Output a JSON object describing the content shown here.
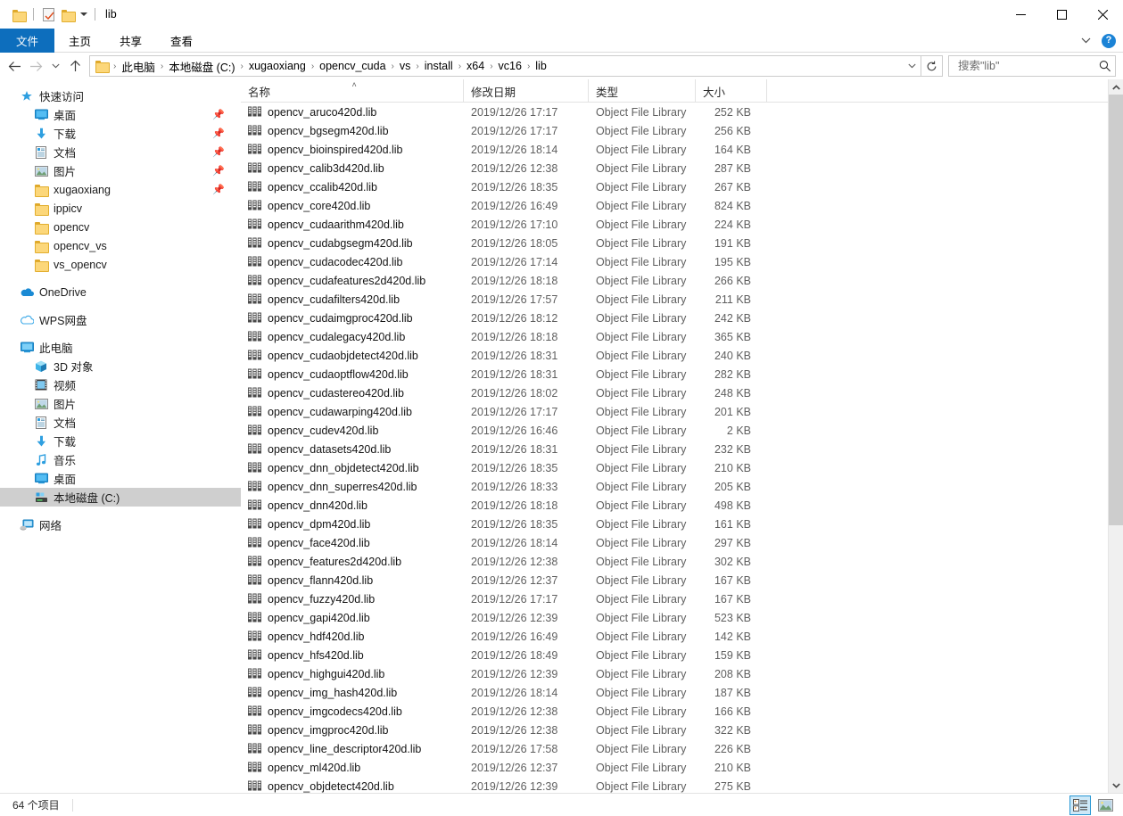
{
  "window": {
    "title": "lib",
    "quick_access": [
      {
        "name": "folder-icon",
        "label": "打开"
      },
      {
        "name": "properties-icon",
        "label": "属性"
      },
      {
        "name": "new-folder-icon",
        "label": "新建文件夹"
      }
    ],
    "controls": {
      "minimize": "─",
      "maximize": "□",
      "close": "✕"
    }
  },
  "ribbon": {
    "tabs": [
      {
        "label": "文件",
        "active": true
      },
      {
        "label": "主页",
        "active": false
      },
      {
        "label": "共享",
        "active": false
      },
      {
        "label": "查看",
        "active": false
      }
    ],
    "collapse_label": "⌄",
    "help_label": "?"
  },
  "addressbar": {
    "back": "←",
    "forward": "→",
    "recent": "⌄",
    "up": "↑",
    "crumbs": [
      "此电脑",
      "本地磁盘 (C:)",
      "xugaoxiang",
      "opencv_cuda",
      "vs",
      "install",
      "x64",
      "vc16",
      "lib"
    ],
    "separator": "›",
    "dropdown": "⌄",
    "refresh": "↻"
  },
  "search": {
    "placeholder": "搜索\"lib\"",
    "value": "",
    "icon": "search-icon"
  },
  "sidebar": {
    "groups": [
      {
        "header": {
          "label": "快速访问",
          "icon": "star-icon",
          "level": 0
        },
        "items": [
          {
            "label": "桌面",
            "icon": "desktop-icon",
            "pinned": true
          },
          {
            "label": "下载",
            "icon": "download-icon",
            "pinned": true
          },
          {
            "label": "文档",
            "icon": "documents-icon",
            "pinned": true
          },
          {
            "label": "图片",
            "icon": "pictures-icon",
            "pinned": true
          },
          {
            "label": "xugaoxiang",
            "icon": "folder-icon",
            "pinned": true
          },
          {
            "label": "ippicv",
            "icon": "folder-icon",
            "pinned": false
          },
          {
            "label": "opencv",
            "icon": "folder-icon",
            "pinned": false
          },
          {
            "label": "opencv_vs",
            "icon": "folder-icon",
            "pinned": false
          },
          {
            "label": "vs_opencv",
            "icon": "folder-icon",
            "pinned": false
          }
        ]
      },
      {
        "header": {
          "label": "OneDrive",
          "icon": "onedrive-icon",
          "level": 0
        },
        "items": []
      },
      {
        "header": {
          "label": "WPS网盘",
          "icon": "wps-cloud-icon",
          "level": 0
        },
        "items": []
      },
      {
        "header": {
          "label": "此电脑",
          "icon": "this-pc-icon",
          "level": 0
        },
        "items": [
          {
            "label": "3D 对象",
            "icon": "3d-objects-icon",
            "pinned": false
          },
          {
            "label": "视频",
            "icon": "videos-icon",
            "pinned": false
          },
          {
            "label": "图片",
            "icon": "pictures-icon",
            "pinned": false
          },
          {
            "label": "文档",
            "icon": "documents-icon",
            "pinned": false
          },
          {
            "label": "下载",
            "icon": "download-icon",
            "pinned": false
          },
          {
            "label": "音乐",
            "icon": "music-icon",
            "pinned": false
          },
          {
            "label": "桌面",
            "icon": "desktop-icon",
            "pinned": false
          },
          {
            "label": "本地磁盘 (C:)",
            "icon": "drive-icon",
            "pinned": false,
            "selected": true
          }
        ]
      },
      {
        "header": {
          "label": "网络",
          "icon": "network-icon",
          "level": 0
        },
        "items": []
      }
    ]
  },
  "filelist": {
    "columns": [
      {
        "label": "名称",
        "sorted": true,
        "sort_glyph": "˄"
      },
      {
        "label": "修改日期",
        "sorted": false
      },
      {
        "label": "类型",
        "sorted": false
      },
      {
        "label": "大小",
        "sorted": false
      }
    ],
    "rows": [
      {
        "name": "opencv_aruco420d.lib",
        "date": "2019/12/26 17:17",
        "type": "Object File Library",
        "size": "252 KB"
      },
      {
        "name": "opencv_bgsegm420d.lib",
        "date": "2019/12/26 17:17",
        "type": "Object File Library",
        "size": "256 KB"
      },
      {
        "name": "opencv_bioinspired420d.lib",
        "date": "2019/12/26 18:14",
        "type": "Object File Library",
        "size": "164 KB"
      },
      {
        "name": "opencv_calib3d420d.lib",
        "date": "2019/12/26 12:38",
        "type": "Object File Library",
        "size": "287 KB"
      },
      {
        "name": "opencv_ccalib420d.lib",
        "date": "2019/12/26 18:35",
        "type": "Object File Library",
        "size": "267 KB"
      },
      {
        "name": "opencv_core420d.lib",
        "date": "2019/12/26 16:49",
        "type": "Object File Library",
        "size": "824 KB"
      },
      {
        "name": "opencv_cudaarithm420d.lib",
        "date": "2019/12/26 17:10",
        "type": "Object File Library",
        "size": "224 KB"
      },
      {
        "name": "opencv_cudabgsegm420d.lib",
        "date": "2019/12/26 18:05",
        "type": "Object File Library",
        "size": "191 KB"
      },
      {
        "name": "opencv_cudacodec420d.lib",
        "date": "2019/12/26 17:14",
        "type": "Object File Library",
        "size": "195 KB"
      },
      {
        "name": "opencv_cudafeatures2d420d.lib",
        "date": "2019/12/26 18:18",
        "type": "Object File Library",
        "size": "266 KB"
      },
      {
        "name": "opencv_cudafilters420d.lib",
        "date": "2019/12/26 17:57",
        "type": "Object File Library",
        "size": "211 KB"
      },
      {
        "name": "opencv_cudaimgproc420d.lib",
        "date": "2019/12/26 18:12",
        "type": "Object File Library",
        "size": "242 KB"
      },
      {
        "name": "opencv_cudalegacy420d.lib",
        "date": "2019/12/26 18:18",
        "type": "Object File Library",
        "size": "365 KB"
      },
      {
        "name": "opencv_cudaobjdetect420d.lib",
        "date": "2019/12/26 18:31",
        "type": "Object File Library",
        "size": "240 KB"
      },
      {
        "name": "opencv_cudaoptflow420d.lib",
        "date": "2019/12/26 18:31",
        "type": "Object File Library",
        "size": "282 KB"
      },
      {
        "name": "opencv_cudastereo420d.lib",
        "date": "2019/12/26 18:02",
        "type": "Object File Library",
        "size": "248 KB"
      },
      {
        "name": "opencv_cudawarping420d.lib",
        "date": "2019/12/26 17:17",
        "type": "Object File Library",
        "size": "201 KB"
      },
      {
        "name": "opencv_cudev420d.lib",
        "date": "2019/12/26 16:46",
        "type": "Object File Library",
        "size": "2 KB"
      },
      {
        "name": "opencv_datasets420d.lib",
        "date": "2019/12/26 18:31",
        "type": "Object File Library",
        "size": "232 KB"
      },
      {
        "name": "opencv_dnn_objdetect420d.lib",
        "date": "2019/12/26 18:35",
        "type": "Object File Library",
        "size": "210 KB"
      },
      {
        "name": "opencv_dnn_superres420d.lib",
        "date": "2019/12/26 18:33",
        "type": "Object File Library",
        "size": "205 KB"
      },
      {
        "name": "opencv_dnn420d.lib",
        "date": "2019/12/26 18:18",
        "type": "Object File Library",
        "size": "498 KB"
      },
      {
        "name": "opencv_dpm420d.lib",
        "date": "2019/12/26 18:35",
        "type": "Object File Library",
        "size": "161 KB"
      },
      {
        "name": "opencv_face420d.lib",
        "date": "2019/12/26 18:14",
        "type": "Object File Library",
        "size": "297 KB"
      },
      {
        "name": "opencv_features2d420d.lib",
        "date": "2019/12/26 12:38",
        "type": "Object File Library",
        "size": "302 KB"
      },
      {
        "name": "opencv_flann420d.lib",
        "date": "2019/12/26 12:37",
        "type": "Object File Library",
        "size": "167 KB"
      },
      {
        "name": "opencv_fuzzy420d.lib",
        "date": "2019/12/26 17:17",
        "type": "Object File Library",
        "size": "167 KB"
      },
      {
        "name": "opencv_gapi420d.lib",
        "date": "2019/12/26 12:39",
        "type": "Object File Library",
        "size": "523 KB"
      },
      {
        "name": "opencv_hdf420d.lib",
        "date": "2019/12/26 16:49",
        "type": "Object File Library",
        "size": "142 KB"
      },
      {
        "name": "opencv_hfs420d.lib",
        "date": "2019/12/26 18:49",
        "type": "Object File Library",
        "size": "159 KB"
      },
      {
        "name": "opencv_highgui420d.lib",
        "date": "2019/12/26 12:39",
        "type": "Object File Library",
        "size": "208 KB"
      },
      {
        "name": "opencv_img_hash420d.lib",
        "date": "2019/12/26 18:14",
        "type": "Object File Library",
        "size": "187 KB"
      },
      {
        "name": "opencv_imgcodecs420d.lib",
        "date": "2019/12/26 12:38",
        "type": "Object File Library",
        "size": "166 KB"
      },
      {
        "name": "opencv_imgproc420d.lib",
        "date": "2019/12/26 12:38",
        "type": "Object File Library",
        "size": "322 KB"
      },
      {
        "name": "opencv_line_descriptor420d.lib",
        "date": "2019/12/26 17:58",
        "type": "Object File Library",
        "size": "226 KB"
      },
      {
        "name": "opencv_ml420d.lib",
        "date": "2019/12/26 12:37",
        "type": "Object File Library",
        "size": "210 KB"
      },
      {
        "name": "opencv_objdetect420d.lib",
        "date": "2019/12/26 12:39",
        "type": "Object File Library",
        "size": "275 KB"
      }
    ]
  },
  "statusbar": {
    "item_count": "64 个项目",
    "views": [
      {
        "name": "details-view-button",
        "active": true
      },
      {
        "name": "large-icons-view-button",
        "active": false
      }
    ]
  }
}
